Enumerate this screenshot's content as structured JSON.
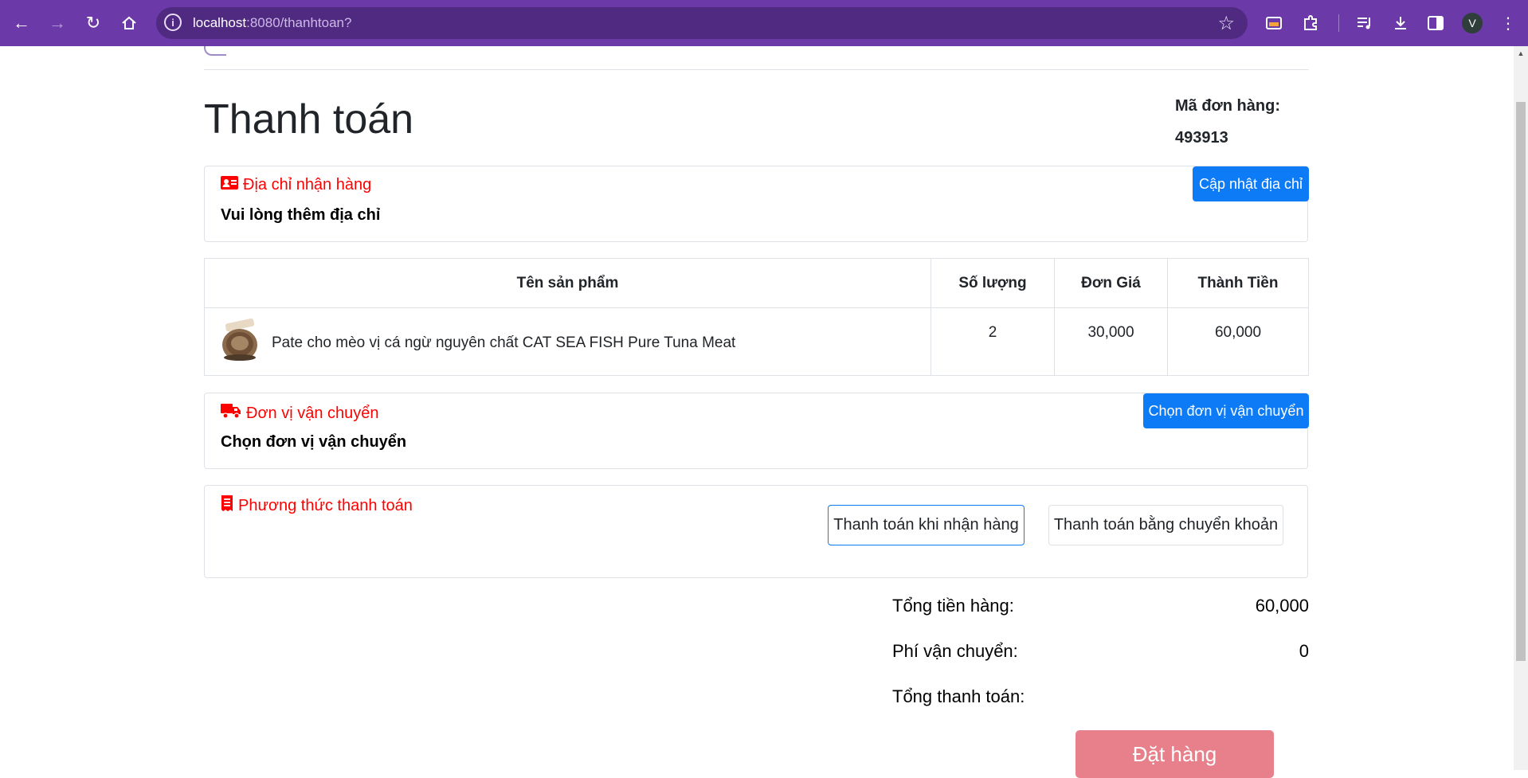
{
  "browser": {
    "url_host": "localhost",
    "url_rest": ":8080/thanhtoan?",
    "avatar_letter": "V",
    "accent_color": "#6b3aa8"
  },
  "page": {
    "title": "Thanh toán",
    "order_code_label": "Mã đơn hàng:",
    "order_code_value": "493913"
  },
  "address": {
    "title": "Địa chỉ nhận hàng",
    "message": "Vui lòng thêm địa chỉ",
    "update_button": "Cập nhật địa chỉ",
    "icon": "id-card-icon"
  },
  "table": {
    "headers": [
      "Tên sản phẩm",
      "Số lượng",
      "Đơn Giá",
      "Thành Tiền"
    ],
    "rows": [
      {
        "name": "Pate cho mèo vị cá ngừ nguyên chất CAT SEA FISH Pure Tuna Meat",
        "quantity": "2",
        "unit_price": "30,000",
        "total": "60,000"
      }
    ]
  },
  "shipping": {
    "title": "Đơn vị vận chuyển",
    "message": "Chọn đơn vị vận chuyển",
    "choose_button": "Chọn đơn vị vận chuyển",
    "icon": "truck-icon"
  },
  "payment": {
    "title": "Phương thức thanh toán",
    "option_cod": "Thanh toán khi nhận hàng",
    "option_transfer": "Thanh toán bằng chuyển khoản",
    "selected": "option_cod",
    "icon": "receipt-icon"
  },
  "summary": {
    "subtotal_label": "Tổng tiền hàng:",
    "subtotal_value": "60,000",
    "shipping_label": "Phí vận chuyển:",
    "shipping_value": "0",
    "grand_total_label": "Tổng thanh toán:",
    "grand_total_value": ""
  },
  "order_button": "Đặt hàng",
  "colors": {
    "primary": "#0d7bf6",
    "danger_text": "#ff0000",
    "order_button": "#e7808a"
  }
}
